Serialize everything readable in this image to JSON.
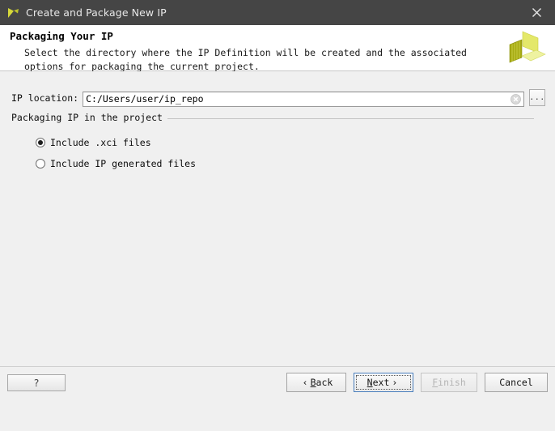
{
  "titlebar": {
    "title": "Create and Package New IP",
    "app_icon": "xilinx-logo-icon",
    "close_icon": "close-icon"
  },
  "banner": {
    "heading": "Packaging Your IP",
    "description": "Select the directory where the IP Definition will be created and the associated options for packaging the current project.",
    "logo_icon": "xilinx-3d-logo-icon"
  },
  "form": {
    "ip_location": {
      "label": "IP location:",
      "value": "C:/Users/user/ip_repo",
      "placeholder": "",
      "clear_icon": "clear-circle-icon",
      "browse_label": "...",
      "browse_icon": "ellipsis-icon"
    },
    "group": {
      "title": "Packaging IP in the project",
      "options": [
        {
          "label": "Include .xci files",
          "checked": true
        },
        {
          "label": "Include IP generated files",
          "checked": false
        }
      ]
    }
  },
  "footer": {
    "help_label": "?",
    "back": {
      "label": "Back",
      "prefix": "‹",
      "mnemonic": "B",
      "pre": "",
      "post": "ack"
    },
    "next": {
      "label": "Next",
      "suffix": "›",
      "mnemonic": "N",
      "pre": "",
      "post": "ext"
    },
    "finish": {
      "label": "Finish",
      "mnemonic": "F",
      "post": "inish",
      "disabled": true
    },
    "cancel": {
      "label": "Cancel"
    }
  },
  "colors": {
    "titlebar_bg": "#454545",
    "banner_bg": "#ffffff",
    "body_bg": "#f0f0f0",
    "accent_focus": "#4a7fbd",
    "logo_yellow": "#d8dc2a",
    "logo_olive": "#9aa017",
    "disabled_text": "#b4b4b4"
  }
}
